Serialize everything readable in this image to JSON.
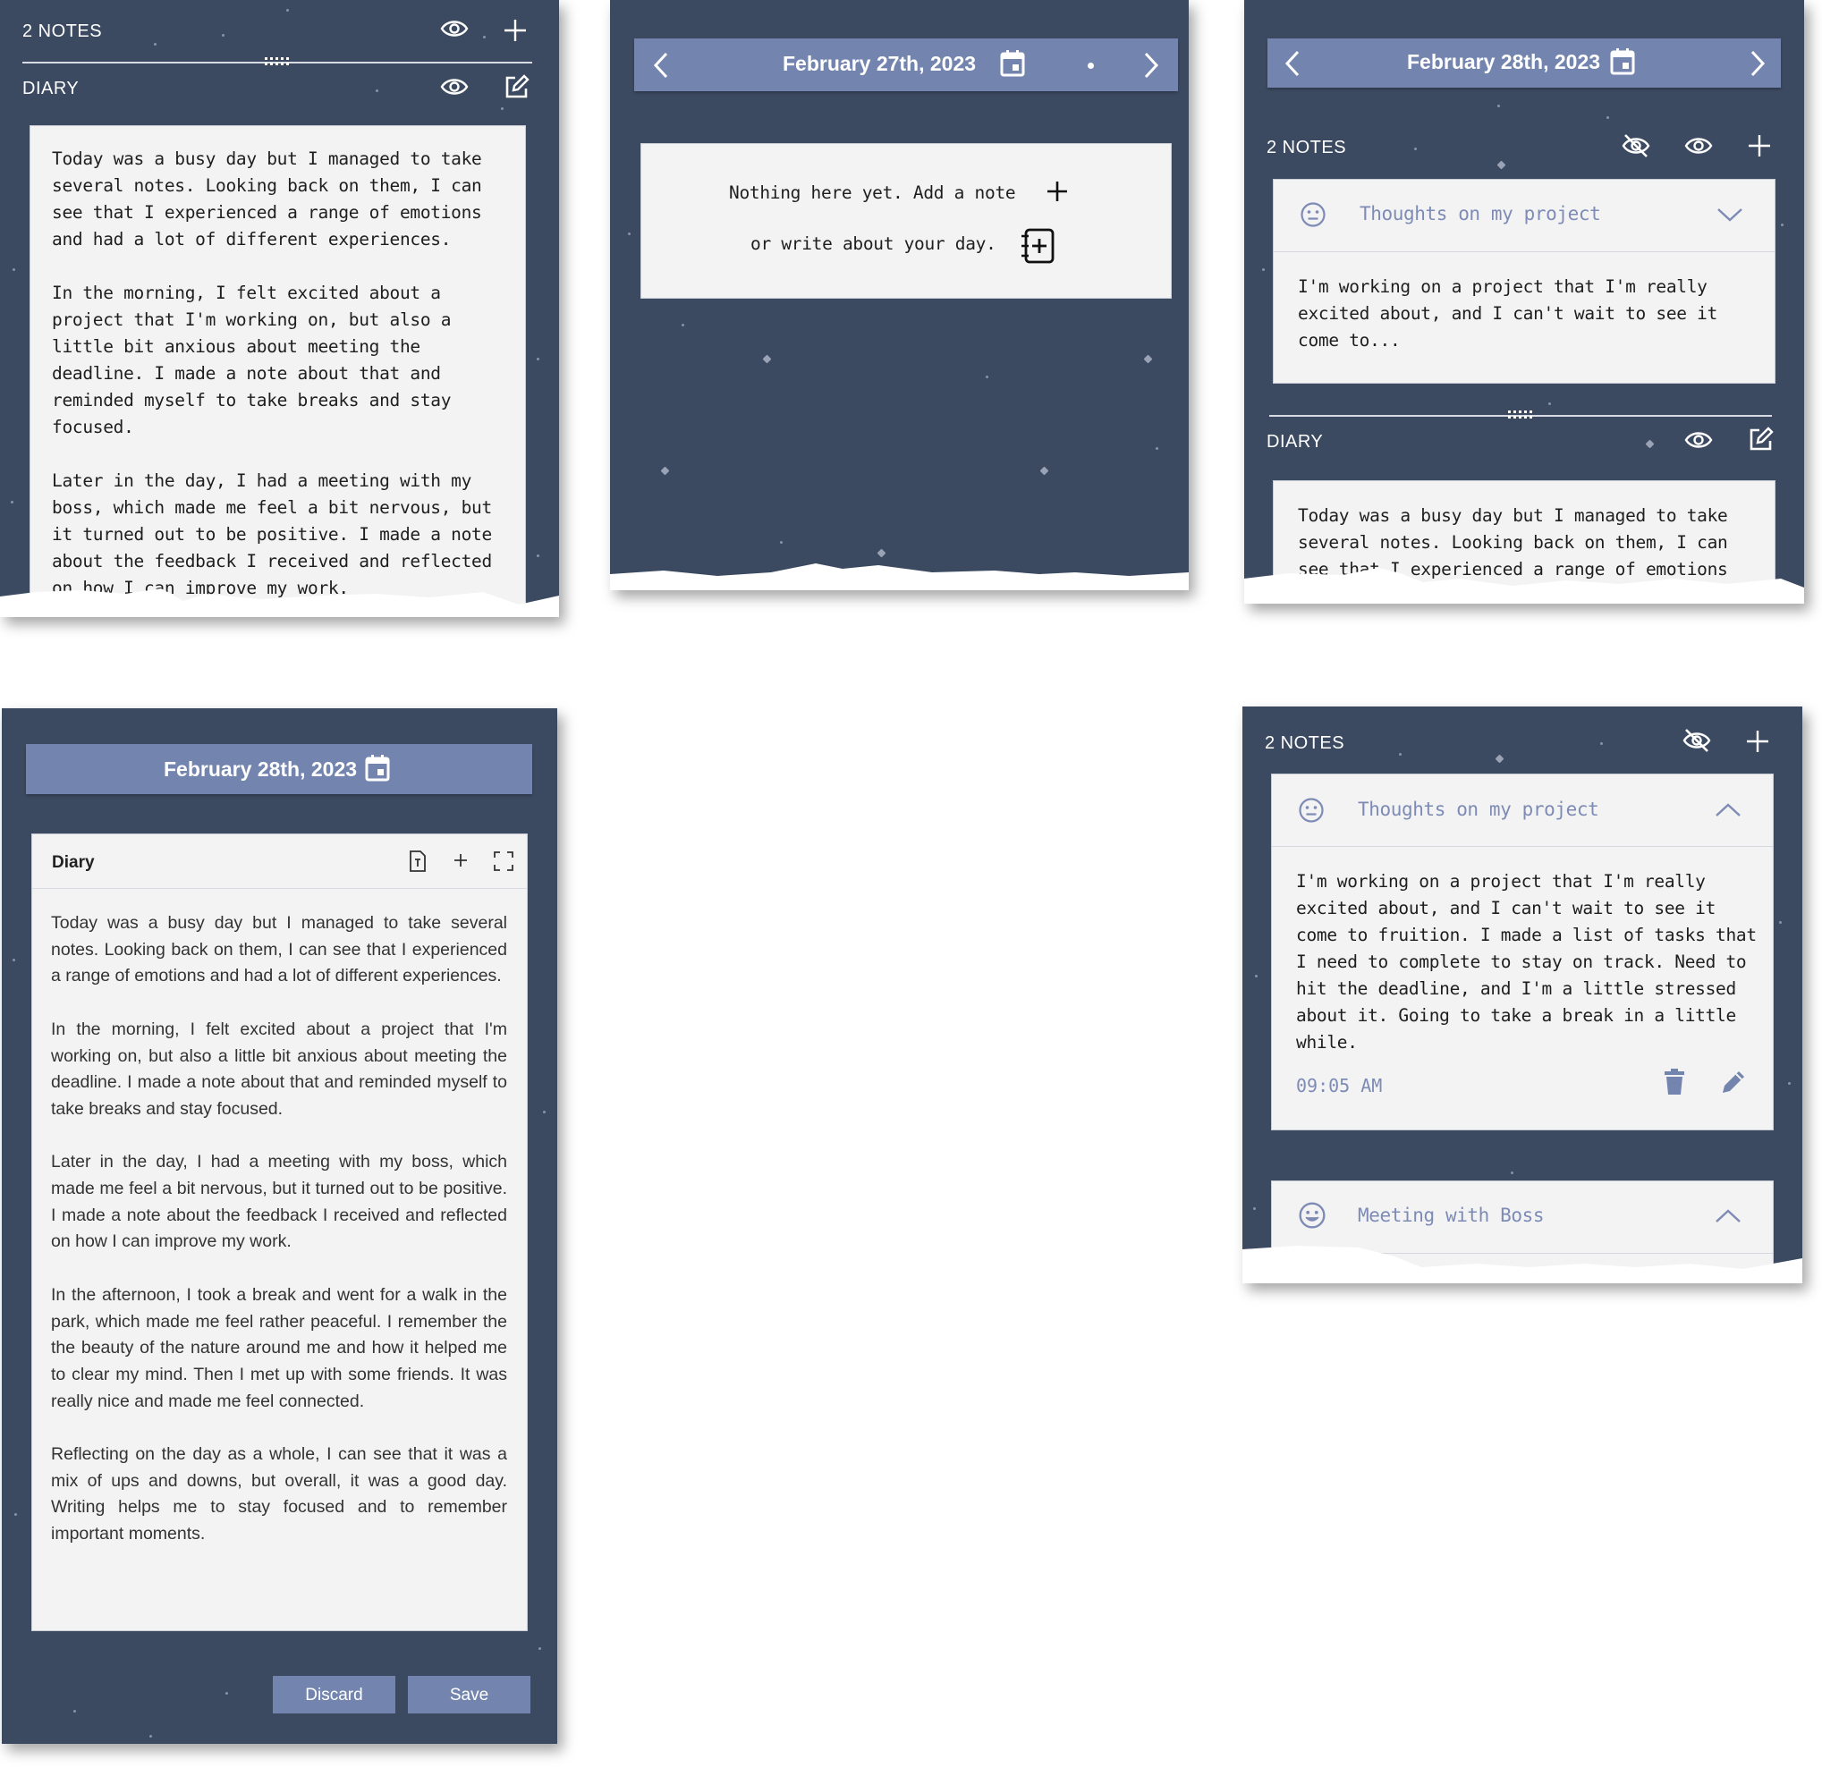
{
  "panel1": {
    "notes_header": "2 NOTES",
    "diary_header": "DIARY",
    "diary_paragraphs": [
      "Today was a busy day but I managed to take several notes. Looking back on them, I can see that I experienced a range of emotions and had a lot of different experiences.",
      "In the morning, I felt excited about a project that I'm working on, but also a little bit anxious about meeting the deadline. I made a note about that and reminded myself to take breaks and stay focused.",
      "Later in the day, I had a meeting with my boss, which made me feel a bit nervous, but it turned out to be positive. I made a note about the feedback I received and reflected on how I can improve my work."
    ]
  },
  "panel2": {
    "date": "February 27th, 2023",
    "empty_line1": "Nothing here yet. Add a note",
    "empty_line2": "or write about your day."
  },
  "panel3": {
    "date": "February 28th, 2023",
    "notes_header": "2 NOTES",
    "note_title": "Thoughts on my project",
    "note_preview": "I'm working on a project that I'm really excited about, and I can't wait to see it come to...",
    "diary_header": "DIARY",
    "diary_preview": "Today was a busy day but I managed to take several notes. Looking back on them, I can see that I experienced a range of emotions"
  },
  "panel4": {
    "date": "February 28th, 2023",
    "editor_title": "Diary",
    "paragraphs": [
      "Today was a busy day but I managed to take several notes. Looking back on them, I can see that I experienced a range of emotions and had a lot of different experiences.",
      "In the morning, I felt excited about a project that I'm working on, but also a little bit anxious about meeting the deadline. I made a note about that and reminded myself to take breaks and stay focused.",
      "Later in the day, I had a meeting with my boss, which made me feel a bit nervous, but it turned out to be positive. I made a note about the feedback I received and reflected on how I can improve my work.",
      "In the afternoon, I took a break and went for a walk in the park, which made me feel rather peaceful. I remember the the beauty of the nature around me and how it helped me to clear my mind. Then I met up with some friends. It was really nice and made me feel connected.",
      "Reflecting on the day as a whole, I can see that it was a mix of ups and downs, but overall, it was a good day. Writing helps me to stay focused and to remember important moments."
    ],
    "discard_label": "Discard",
    "save_label": "Save"
  },
  "panel5": {
    "notes_header": "2 NOTES",
    "note1_title": "Thoughts on my project",
    "note1_body": "I'm working on a project that I'm really excited about, and I can't wait to see it come to fruition. I made a list of tasks that I need to complete to stay on track. Need to hit the deadline, and I'm a little stressed about it. Going to take a break in a little while.",
    "note1_time": "09:05 AM",
    "note2_title": "Meeting with Boss"
  },
  "colors": {
    "panel_bg": "#3c4a61",
    "accent": "#7385ae",
    "card_bg": "#f3f3f4",
    "note_title": "#7d8bb5"
  }
}
